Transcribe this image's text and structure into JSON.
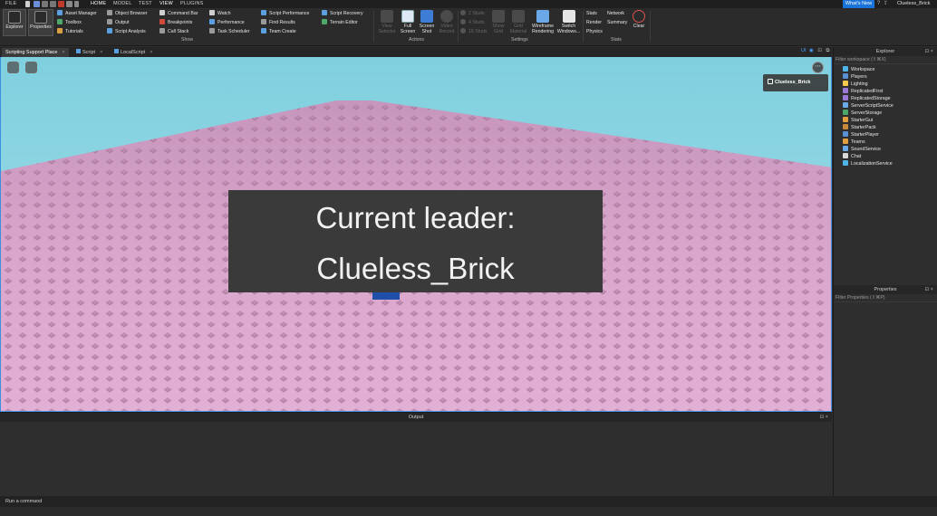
{
  "menubar": {
    "file": "FILE",
    "tabs": [
      "HOME",
      "MODEL",
      "TEST",
      "VIEW",
      "PLUGINS"
    ],
    "active_tab": "VIEW",
    "whats_new": "What's New",
    "username": "Clueless_Brick"
  },
  "ribbon": {
    "explorer": "Explorer",
    "properties": "Properties",
    "show_col1": [
      "Asset Manager",
      "Toolbox",
      "Tutorials"
    ],
    "show_col2": [
      "Object Browser",
      "Output",
      "Script Analysis"
    ],
    "show_col3": [
      "Command Bar",
      "Breakpoints",
      "Call Stack"
    ],
    "show_col4": [
      "Watch",
      "Performance",
      "Task Scheduler"
    ],
    "show_col5": [
      "Script Performance",
      "Find Results",
      "Team Create"
    ],
    "show_col6": [
      "Script Recovery",
      "Terrain Editor"
    ],
    "show_group": "Show",
    "view_selector": [
      "View",
      "Selector"
    ],
    "full_screen": [
      "Full",
      "Screen"
    ],
    "screen_shot": [
      "Screen",
      "Shot"
    ],
    "video_record": [
      "Video",
      "Record"
    ],
    "actions_group": "Actions",
    "studs": [
      "2 Studs",
      "4 Studs",
      "16 Studs"
    ],
    "show_grid": [
      "Show",
      "Grid"
    ],
    "grid_material": [
      "Grid",
      "Material"
    ],
    "wireframe": [
      "Wireframe",
      "Rendering"
    ],
    "switch_windows": [
      "Switch",
      "Windows..."
    ],
    "settings_group": "Settings",
    "stats_col1": [
      "Stats",
      "Render",
      "Physics"
    ],
    "stats_col2": [
      "Network",
      "Summary"
    ],
    "clear": "Clear",
    "stats_group": "Stats"
  },
  "tabs": [
    {
      "label": "Scripting Support Place"
    },
    {
      "label": "Script"
    },
    {
      "label": "LocalScript"
    }
  ],
  "viewport": {
    "tools_label": "UI",
    "player_chip": "Clueless_Brick",
    "leader_line1": "Current leader:",
    "leader_line2": "Clueless_Brick",
    "menu_glyph": "⋯"
  },
  "output": {
    "title": "Output",
    "command_placeholder": "Run a command"
  },
  "explorer": {
    "title": "Explorer",
    "filter": "Filter workspace (⇧⌘X)",
    "items": [
      {
        "label": "Workspace",
        "color": "#4fb3e8"
      },
      {
        "label": "Players",
        "color": "#5a8fd6"
      },
      {
        "label": "Lighting",
        "color": "#f2c94c"
      },
      {
        "label": "ReplicatedFirst",
        "color": "#9b7ad6"
      },
      {
        "label": "ReplicatedStorage",
        "color": "#9b7ad6"
      },
      {
        "label": "ServerScriptService",
        "color": "#6aa8e8"
      },
      {
        "label": "ServerStorage",
        "color": "#4aa86a"
      },
      {
        "label": "StarterGui",
        "color": "#e0a040"
      },
      {
        "label": "StarterPack",
        "color": "#c9893a"
      },
      {
        "label": "StarterPlayer",
        "color": "#5a8fd6"
      },
      {
        "label": "Teams",
        "color": "#e0a040"
      },
      {
        "label": "SoundService",
        "color": "#6aa8e8"
      },
      {
        "label": "Chat",
        "color": "#d8d8d8"
      },
      {
        "label": "LocalizationService",
        "color": "#4fb3e8"
      }
    ]
  },
  "properties": {
    "title": "Properties",
    "filter": "Filter Properties (⇧⌘P)"
  },
  "colors": {
    "accent": "#3a8fe0",
    "sky_top": "#7fcfdf",
    "baseplate": "#d9a6cc",
    "leader_bg": "#3a3a3a"
  }
}
